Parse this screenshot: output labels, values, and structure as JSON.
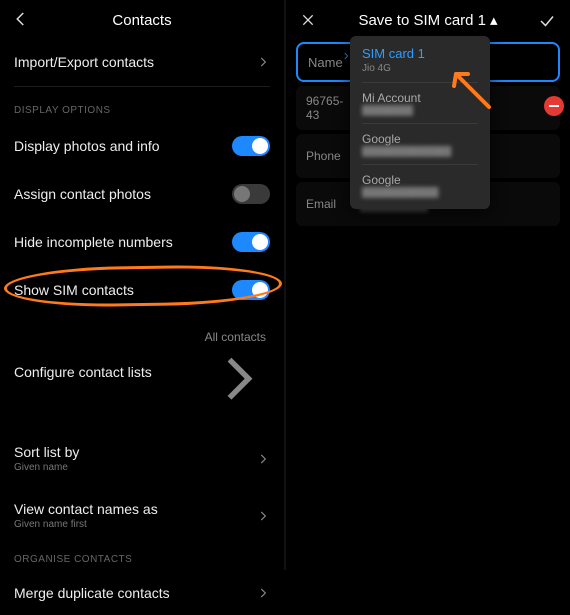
{
  "left": {
    "title": "Contacts",
    "import_export": "Import/Export contacts",
    "section_display": "DISPLAY OPTIONS",
    "items": [
      {
        "label": "Display photos and info",
        "kind": "toggle",
        "on": true
      },
      {
        "label": "Assign contact photos",
        "kind": "toggle",
        "on": false
      },
      {
        "label": "Hide incomplete numbers",
        "kind": "toggle",
        "on": true
      },
      {
        "label": "Show SIM contacts",
        "kind": "toggle",
        "on": true
      },
      {
        "label": "Configure contact lists",
        "kind": "link",
        "secondary": "All contacts"
      },
      {
        "label": "Sort list by",
        "kind": "link",
        "sub": "Given name"
      },
      {
        "label": "View contact names as",
        "kind": "link",
        "sub": "Given name first"
      }
    ],
    "section_organise": "ORGANISE CONTACTS",
    "merge": "Merge duplicate contacts"
  },
  "right": {
    "title": "Save to SIM card 1",
    "name_placeholder": "Name",
    "rows": [
      {
        "lhs": "96765-43",
        "val": ""
      },
      {
        "lhs": "Phone",
        "val": ""
      },
      {
        "lhs": "Email",
        "val": ""
      }
    ],
    "popup": {
      "selected": "SIM card 1",
      "selected_sub": "Jio 4G",
      "alt1": "Mi Account",
      "alt2": "Google",
      "alt3": "Google"
    }
  }
}
